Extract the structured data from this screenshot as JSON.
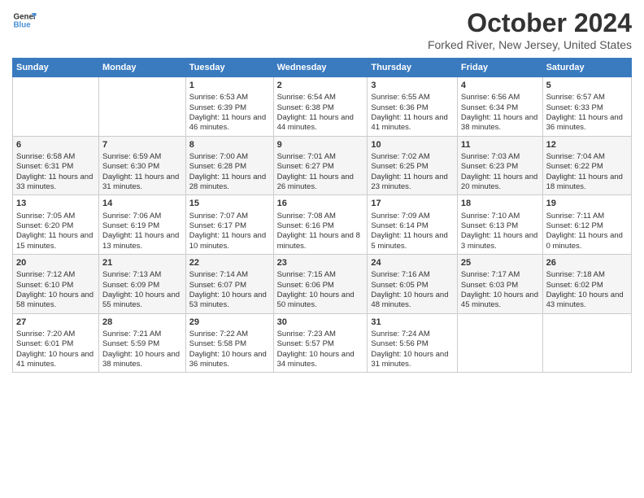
{
  "logo": {
    "line1": "General",
    "line2": "Blue"
  },
  "title": "October 2024",
  "subtitle": "Forked River, New Jersey, United States",
  "days_of_week": [
    "Sunday",
    "Monday",
    "Tuesday",
    "Wednesday",
    "Thursday",
    "Friday",
    "Saturday"
  ],
  "weeks": [
    [
      {
        "day": "",
        "content": ""
      },
      {
        "day": "",
        "content": ""
      },
      {
        "day": "1",
        "content": "Sunrise: 6:53 AM\nSunset: 6:39 PM\nDaylight: 11 hours and 46 minutes."
      },
      {
        "day": "2",
        "content": "Sunrise: 6:54 AM\nSunset: 6:38 PM\nDaylight: 11 hours and 44 minutes."
      },
      {
        "day": "3",
        "content": "Sunrise: 6:55 AM\nSunset: 6:36 PM\nDaylight: 11 hours and 41 minutes."
      },
      {
        "day": "4",
        "content": "Sunrise: 6:56 AM\nSunset: 6:34 PM\nDaylight: 11 hours and 38 minutes."
      },
      {
        "day": "5",
        "content": "Sunrise: 6:57 AM\nSunset: 6:33 PM\nDaylight: 11 hours and 36 minutes."
      }
    ],
    [
      {
        "day": "6",
        "content": "Sunrise: 6:58 AM\nSunset: 6:31 PM\nDaylight: 11 hours and 33 minutes."
      },
      {
        "day": "7",
        "content": "Sunrise: 6:59 AM\nSunset: 6:30 PM\nDaylight: 11 hours and 31 minutes."
      },
      {
        "day": "8",
        "content": "Sunrise: 7:00 AM\nSunset: 6:28 PM\nDaylight: 11 hours and 28 minutes."
      },
      {
        "day": "9",
        "content": "Sunrise: 7:01 AM\nSunset: 6:27 PM\nDaylight: 11 hours and 26 minutes."
      },
      {
        "day": "10",
        "content": "Sunrise: 7:02 AM\nSunset: 6:25 PM\nDaylight: 11 hours and 23 minutes."
      },
      {
        "day": "11",
        "content": "Sunrise: 7:03 AM\nSunset: 6:23 PM\nDaylight: 11 hours and 20 minutes."
      },
      {
        "day": "12",
        "content": "Sunrise: 7:04 AM\nSunset: 6:22 PM\nDaylight: 11 hours and 18 minutes."
      }
    ],
    [
      {
        "day": "13",
        "content": "Sunrise: 7:05 AM\nSunset: 6:20 PM\nDaylight: 11 hours and 15 minutes."
      },
      {
        "day": "14",
        "content": "Sunrise: 7:06 AM\nSunset: 6:19 PM\nDaylight: 11 hours and 13 minutes."
      },
      {
        "day": "15",
        "content": "Sunrise: 7:07 AM\nSunset: 6:17 PM\nDaylight: 11 hours and 10 minutes."
      },
      {
        "day": "16",
        "content": "Sunrise: 7:08 AM\nSunset: 6:16 PM\nDaylight: 11 hours and 8 minutes."
      },
      {
        "day": "17",
        "content": "Sunrise: 7:09 AM\nSunset: 6:14 PM\nDaylight: 11 hours and 5 minutes."
      },
      {
        "day": "18",
        "content": "Sunrise: 7:10 AM\nSunset: 6:13 PM\nDaylight: 11 hours and 3 minutes."
      },
      {
        "day": "19",
        "content": "Sunrise: 7:11 AM\nSunset: 6:12 PM\nDaylight: 11 hours and 0 minutes."
      }
    ],
    [
      {
        "day": "20",
        "content": "Sunrise: 7:12 AM\nSunset: 6:10 PM\nDaylight: 10 hours and 58 minutes."
      },
      {
        "day": "21",
        "content": "Sunrise: 7:13 AM\nSunset: 6:09 PM\nDaylight: 10 hours and 55 minutes."
      },
      {
        "day": "22",
        "content": "Sunrise: 7:14 AM\nSunset: 6:07 PM\nDaylight: 10 hours and 53 minutes."
      },
      {
        "day": "23",
        "content": "Sunrise: 7:15 AM\nSunset: 6:06 PM\nDaylight: 10 hours and 50 minutes."
      },
      {
        "day": "24",
        "content": "Sunrise: 7:16 AM\nSunset: 6:05 PM\nDaylight: 10 hours and 48 minutes."
      },
      {
        "day": "25",
        "content": "Sunrise: 7:17 AM\nSunset: 6:03 PM\nDaylight: 10 hours and 45 minutes."
      },
      {
        "day": "26",
        "content": "Sunrise: 7:18 AM\nSunset: 6:02 PM\nDaylight: 10 hours and 43 minutes."
      }
    ],
    [
      {
        "day": "27",
        "content": "Sunrise: 7:20 AM\nSunset: 6:01 PM\nDaylight: 10 hours and 41 minutes."
      },
      {
        "day": "28",
        "content": "Sunrise: 7:21 AM\nSunset: 5:59 PM\nDaylight: 10 hours and 38 minutes."
      },
      {
        "day": "29",
        "content": "Sunrise: 7:22 AM\nSunset: 5:58 PM\nDaylight: 10 hours and 36 minutes."
      },
      {
        "day": "30",
        "content": "Sunrise: 7:23 AM\nSunset: 5:57 PM\nDaylight: 10 hours and 34 minutes."
      },
      {
        "day": "31",
        "content": "Sunrise: 7:24 AM\nSunset: 5:56 PM\nDaylight: 10 hours and 31 minutes."
      },
      {
        "day": "",
        "content": ""
      },
      {
        "day": "",
        "content": ""
      }
    ]
  ]
}
